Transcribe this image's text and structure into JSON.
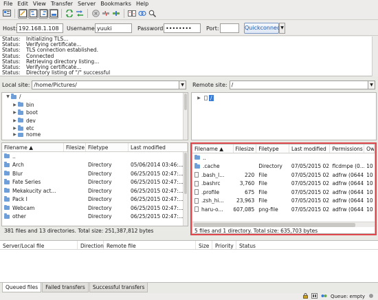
{
  "menu": [
    "File",
    "Edit",
    "View",
    "Transfer",
    "Server",
    "Bookmarks",
    "Help"
  ],
  "quickconnect": {
    "host_label": "Host:",
    "host_value": "192.168.1.108",
    "user_label": "Username:",
    "user_value": "yuuki",
    "pass_label": "Password:",
    "pass_value": "••••••••",
    "port_label": "Port:",
    "port_value": "",
    "button": "Quickconnect"
  },
  "log": [
    {
      "k": "Status:",
      "v": "Initializing TLS..."
    },
    {
      "k": "Status:",
      "v": "Verifying certificate..."
    },
    {
      "k": "Status:",
      "v": "TLS connection established."
    },
    {
      "k": "Status:",
      "v": "Connected"
    },
    {
      "k": "Status:",
      "v": "Retrieving directory listing..."
    },
    {
      "k": "Status:",
      "v": "Verifying certificate..."
    },
    {
      "k": "Status:",
      "v": "Directory listing of \"/\" successful"
    }
  ],
  "local": {
    "label": "Local site:",
    "path": "/home/Pictures/",
    "tree": [
      {
        "name": "/",
        "level": 0,
        "exp": "▼"
      },
      {
        "name": "bin",
        "level": 1,
        "exp": "▶"
      },
      {
        "name": "boot",
        "level": 1,
        "exp": "▶"
      },
      {
        "name": "dev",
        "level": 1,
        "exp": "▶"
      },
      {
        "name": "etc",
        "level": 1,
        "exp": "▶"
      },
      {
        "name": "home",
        "level": 1,
        "exp": "▶"
      }
    ],
    "headers": [
      "Filename",
      "Filesize",
      "Filetype",
      "Last modified"
    ],
    "sort_glyph": "▲",
    "rows": [
      {
        "name": "..",
        "size": "",
        "type": "",
        "date": ""
      },
      {
        "name": "Arch",
        "size": "",
        "type": "Directory",
        "date": "05/06/2014 03:46:..."
      },
      {
        "name": "Blur",
        "size": "",
        "type": "Directory",
        "date": "06/25/2015 02:47:..."
      },
      {
        "name": "Fate Series",
        "size": "",
        "type": "Directory",
        "date": "06/25/2015 02:47:..."
      },
      {
        "name": "Mekakucity act...",
        "size": "",
        "type": "Directory",
        "date": "06/25/2015 02:47:..."
      },
      {
        "name": "Pack I",
        "size": "",
        "type": "Directory",
        "date": "06/25/2015 02:47:..."
      },
      {
        "name": "Webcam",
        "size": "",
        "type": "Directory",
        "date": "06/25/2015 02:47:..."
      },
      {
        "name": "other",
        "size": "",
        "type": "Directory",
        "date": "06/25/2015 02:47:..."
      }
    ],
    "status": "381 files and 13 directories. Total size: 251,387,812 bytes"
  },
  "remote": {
    "label": "Remote site:",
    "path": "/",
    "tree_root": "/",
    "headers": [
      "Filename",
      "Filesize",
      "Filetype",
      "Last modified",
      "Permissions",
      "Ow"
    ],
    "sort_glyph": "▲",
    "rows": [
      {
        "name": "..",
        "size": "",
        "type": "",
        "date": "",
        "perm": "",
        "own": "",
        "kind": "dir"
      },
      {
        "name": ".cache",
        "size": "",
        "type": "Directory",
        "date": "07/05/2015 02...",
        "perm": "flcdmpe (0...",
        "own": "10",
        "kind": "dir"
      },
      {
        "name": ".bash_l...",
        "size": "220",
        "type": "File",
        "date": "07/05/2015 02...",
        "perm": "adfrw (0644)",
        "own": "10",
        "kind": "file"
      },
      {
        "name": ".bashrc",
        "size": "3,760",
        "type": "File",
        "date": "07/05/2015 02...",
        "perm": "adfrw (0644)",
        "own": "10",
        "kind": "file"
      },
      {
        "name": ".profile",
        "size": "675",
        "type": "File",
        "date": "07/05/2015 02...",
        "perm": "adfrw (0644)",
        "own": "10",
        "kind": "file"
      },
      {
        "name": ".zsh_hi...",
        "size": "23,963",
        "type": "File",
        "date": "07/05/2015 02...",
        "perm": "adfrw (0644)",
        "own": "10",
        "kind": "file"
      },
      {
        "name": "haru-o...",
        "size": "607,085",
        "type": "png-file",
        "date": "07/05/2015 02...",
        "perm": "adfrw (0644)",
        "own": "10",
        "kind": "file"
      }
    ],
    "status": "5 files and 1 directory. Total size: 635,703 bytes"
  },
  "queue": {
    "headers": [
      "Server/Local file",
      "Direction",
      "Remote file",
      "Size",
      "Priority",
      "Status"
    ]
  },
  "tabs": [
    "Queued files",
    "Failed transfers",
    "Successful transfers"
  ],
  "statusbar": {
    "queue": "Queue: empty"
  },
  "colors": {
    "highlight": "#e0474c",
    "folder": "#6f9fd8",
    "quickconnect": "#1b57b0"
  }
}
